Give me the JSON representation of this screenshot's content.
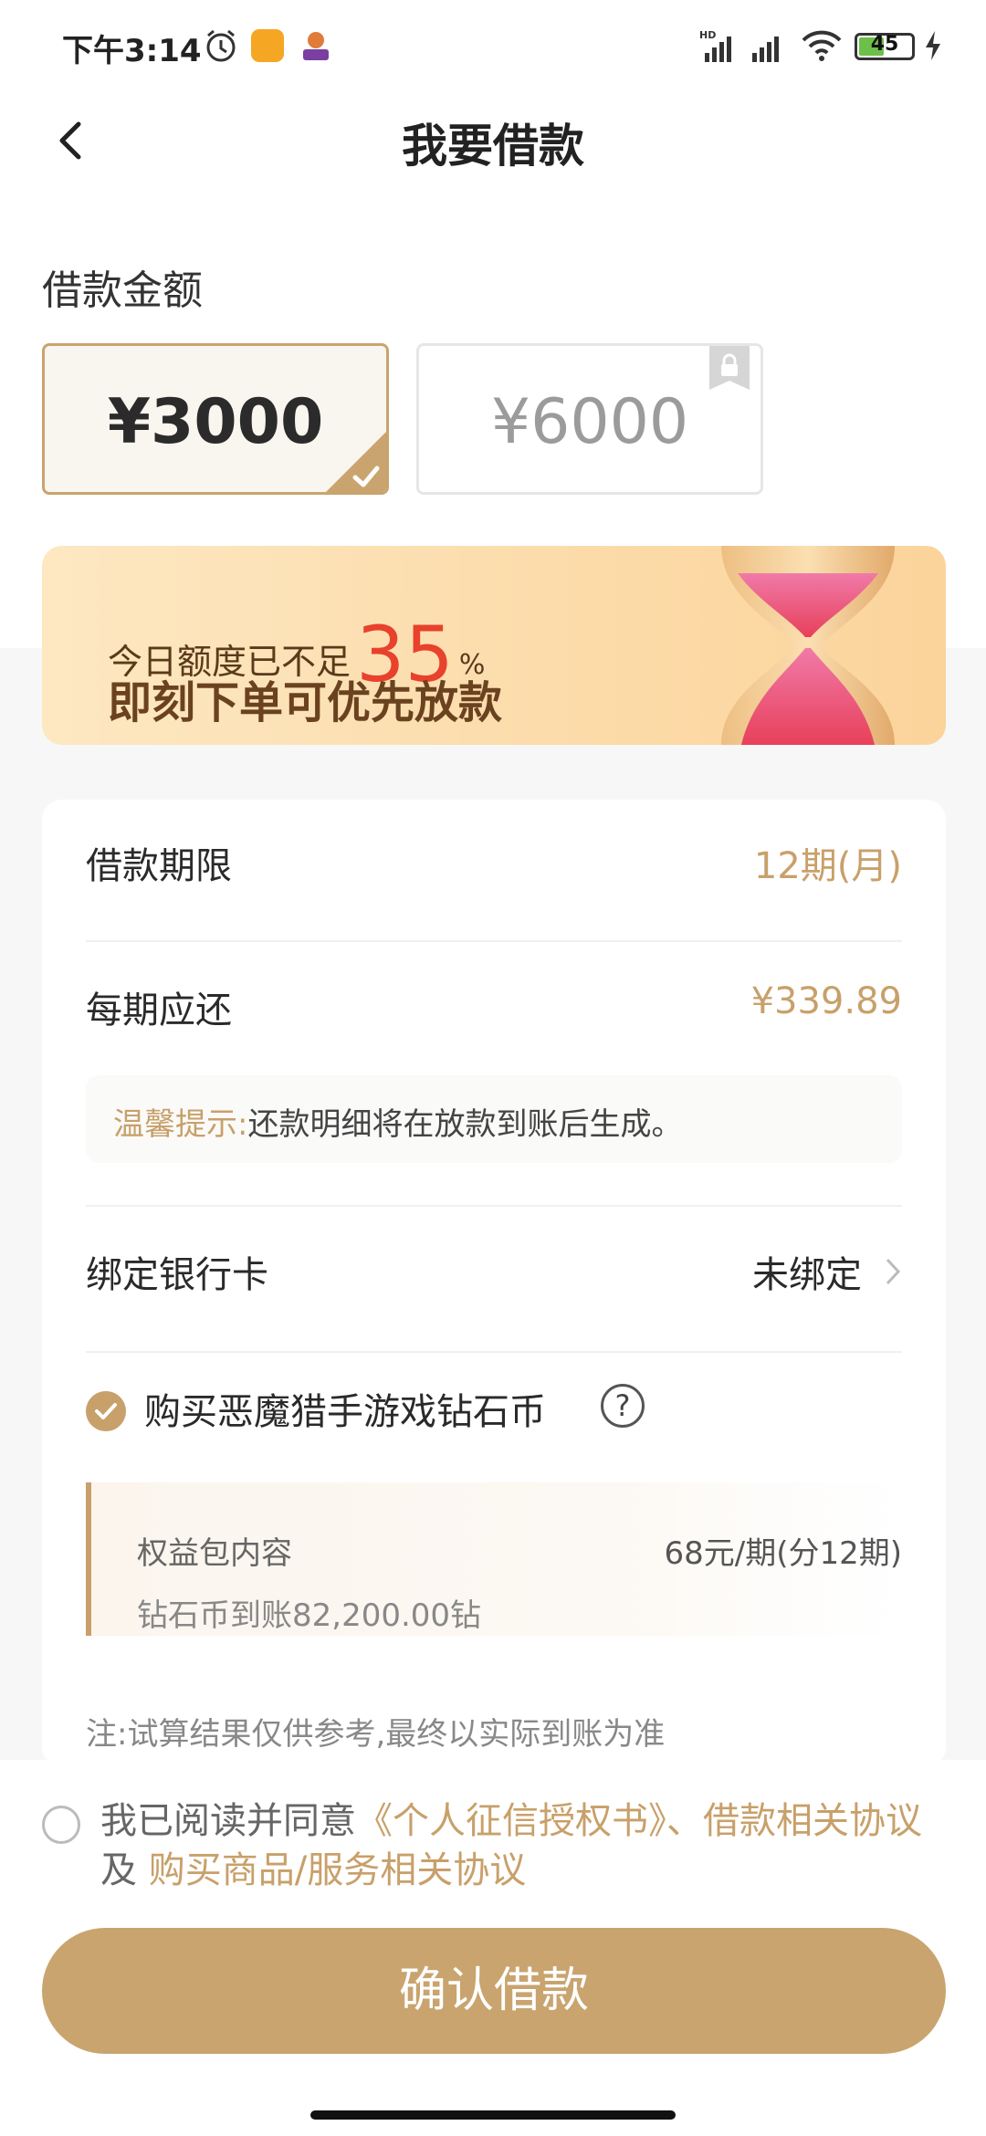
{
  "status_bar": {
    "time": "下午3:14",
    "battery": "45",
    "icons": [
      "alarm-icon",
      "app-notification-icon",
      "app-notification-icon",
      "signal-hd-icon",
      "signal-icon",
      "wifi-icon",
      "battery-icon",
      "charging-icon"
    ]
  },
  "header": {
    "title": "我要借款",
    "back_icon": "chevron-left-icon"
  },
  "amount": {
    "label": "借款金额",
    "options": [
      {
        "text": "¥3000",
        "selected": true
      },
      {
        "text": "¥6000",
        "locked": true
      }
    ]
  },
  "banner": {
    "line1_prefix": "今日额度已不足",
    "percent": "35",
    "percent_sign": "%",
    "line2": "即刻下单可优先放款"
  },
  "details": {
    "term_label": "借款期限",
    "term_value": "12期(月)",
    "installment_label": "每期应还",
    "installment_value": "¥339.89",
    "tip_title": "温馨提示:",
    "tip_text": "还款明细将在放款到账后生成。",
    "bank_label": "绑定银行卡",
    "bank_value": "未绑定",
    "product_label": "购买恶魔猎手游戏钻石币",
    "help_symbol": "?",
    "benefit_title": "权益包内容",
    "benefit_price": "68元/期(分12期)",
    "benefit_sub": "钻石币到账82,200.00钻",
    "note": "注:试算结果仅供参考,最终以实际到账为准"
  },
  "footer": {
    "agree_prefix": "我已阅读并同意",
    "link1": "《个人征信授权书》、借款相关协议",
    "and": " 及 ",
    "link2": "购买商品/服务相关协议",
    "confirm_label": "确认借款"
  },
  "colors": {
    "gold": "#c8a06a",
    "button": "#c9a46f",
    "highlight_red": "#e8412c"
  }
}
